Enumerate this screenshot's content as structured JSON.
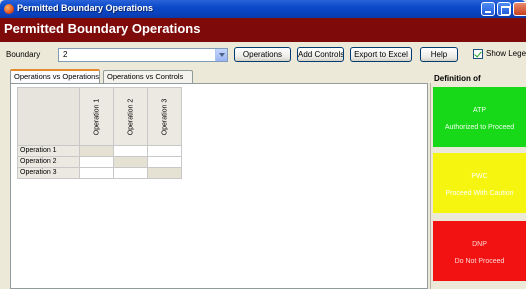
{
  "window": {
    "title": "Permitted Boundary Operations"
  },
  "header": {
    "title": "Permitted Boundary Operations",
    "band_color": "#7e0a0a"
  },
  "toolbar": {
    "boundary_label": "Boundary",
    "boundary_value": "2",
    "operations_label": "Operations",
    "add_controls_label": "Add Controls",
    "export_label": "Export to Excel",
    "help_label": "Help",
    "show_legend_label": "Show Legend",
    "show_legend_checked": true
  },
  "tabs": [
    {
      "label": "Operations vs Operations",
      "active": true
    },
    {
      "label": "Operations vs Controls",
      "active": false
    }
  ],
  "grid": {
    "columns": [
      "Operation 1",
      "Operation 2",
      "Operation 3"
    ],
    "rows": [
      "Operation 1",
      "Operation 2",
      "Operation 3"
    ]
  },
  "definitions": {
    "title": "Definition of",
    "items": [
      {
        "code": "ATP",
        "description": "Authorized to Proceed",
        "color": "#17d917"
      },
      {
        "code": "PWC",
        "description": "Proceed With Caution",
        "color": "#f5f510"
      },
      {
        "code": "DNP",
        "description": "Do Not Proceed",
        "color": "#f21212"
      }
    ]
  }
}
